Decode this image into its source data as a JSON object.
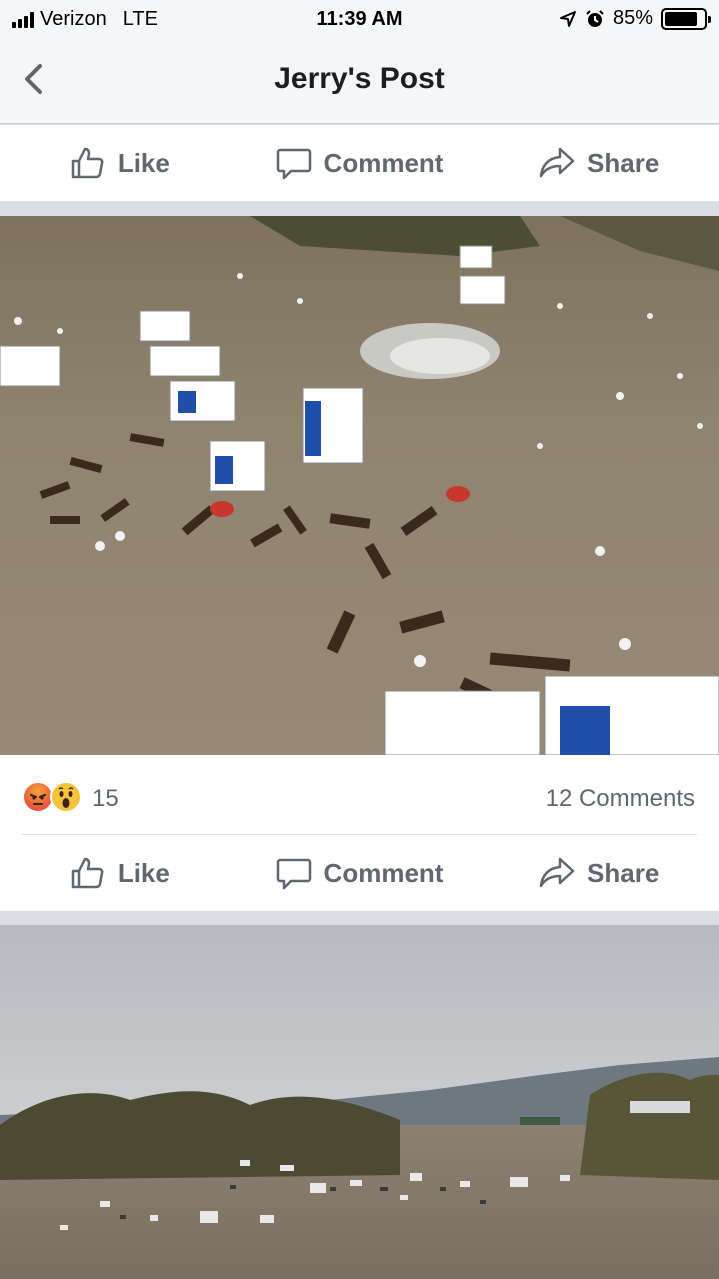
{
  "status_bar": {
    "carrier": "Verizon",
    "network": "LTE",
    "time": "11:39 AM",
    "battery_percent": "85%",
    "battery_level": 0.85
  },
  "nav": {
    "title": "Jerry's Post"
  },
  "actions": {
    "like": "Like",
    "comment": "Comment",
    "share": "Share"
  },
  "reactions": {
    "count": "15",
    "comments": "12 Comments",
    "types": [
      "angry",
      "wow"
    ]
  },
  "colors": {
    "action_text": "#606770",
    "separator": "#dadde1",
    "header_bg": "#f6f7f9"
  }
}
